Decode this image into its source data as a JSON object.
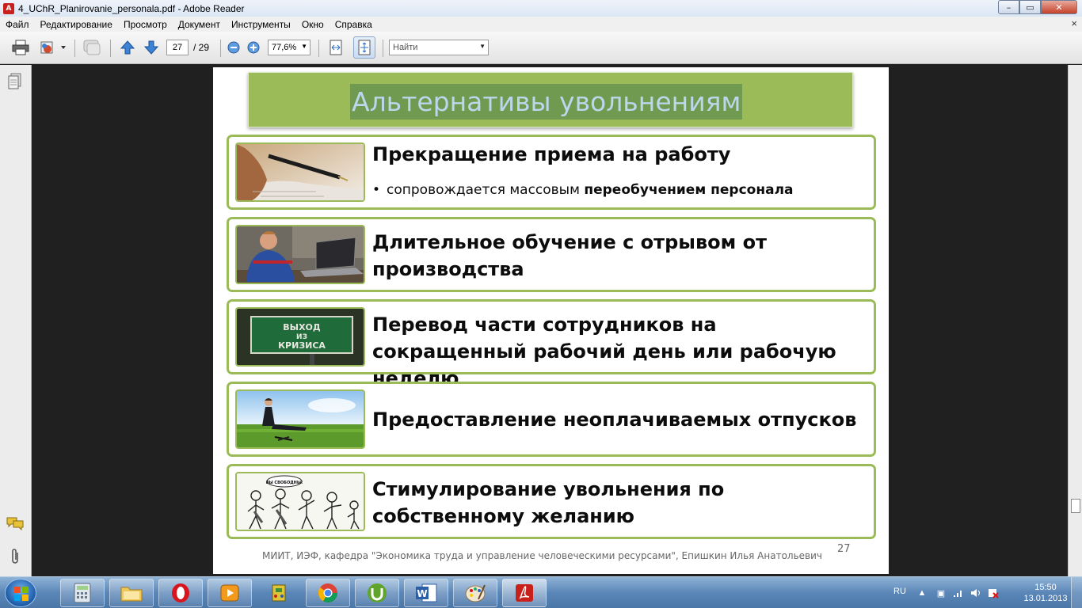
{
  "window": {
    "title": "4_UChR_Planirovanie_personala.pdf - Adobe Reader",
    "minimize": "–",
    "maximize": "▭",
    "close": "✕"
  },
  "menu": [
    "Файл",
    "Редактирование",
    "Просмотр",
    "Документ",
    "Инструменты",
    "Окно",
    "Справка"
  ],
  "menu_close": "×",
  "toolbar": {
    "page_current": "27",
    "page_total": "/ 29",
    "zoom": "77,6%",
    "search_placeholder": "Найти"
  },
  "slide": {
    "title": "Альтернативы увольнениям",
    "items": [
      {
        "title": "Прекращение приема на работу",
        "bullet_prefix": "сопровождается массовым ",
        "bullet_bold": "переобучением персонала"
      },
      {
        "title": "Длительное обучение с отрывом от производства"
      },
      {
        "title": "Перевод части сотрудников на сокращенный рабочий день или рабочую неделю",
        "image_text": [
          "ВЫХОД",
          "ИЗ",
          "КРИЗИСА"
        ]
      },
      {
        "title": "Предоставление неоплачиваемых отпусков"
      },
      {
        "title": "Стимулирование увольнения по собственному желанию",
        "image_text": "ВЫ СВОБОДНЫ!"
      }
    ],
    "footer": "МИИТ, ИЭФ, кафедра \"Экономика труда и управление человеческими ресурсами\", Епишкин Илья Анатольевич",
    "page_number": "27"
  },
  "taskbar": {
    "apps": [
      "calculator",
      "explorer",
      "opera",
      "media-player",
      "game",
      "chrome",
      "utorrent",
      "word",
      "paint",
      "adobe-reader"
    ],
    "language": "RU",
    "time": "15:50",
    "date": "13.01.2013"
  },
  "colors": {
    "accent_green": "#9bbb59",
    "title_bg": "#6f9a4f",
    "title_text": "#bcd6ec",
    "adobe_red": "#c8211b"
  }
}
